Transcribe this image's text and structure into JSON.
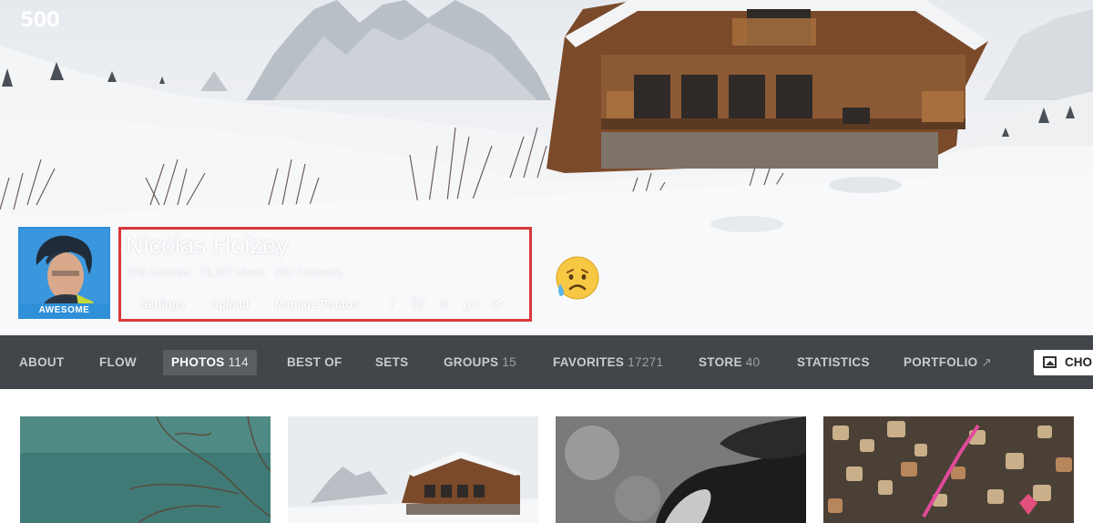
{
  "brand": {
    "logo_text": "500"
  },
  "profile": {
    "name": "Nicolas Hoizey",
    "avatar_badge": "AWESOME",
    "stats": {
      "affection": "976 Affection",
      "views": "78,387 Views",
      "followers": "353 Followers"
    },
    "actions": {
      "settings": "Settings",
      "upload": "Upload",
      "manage_photos": "Manage Photos"
    },
    "social_icons": [
      "facebook-icon",
      "twitter-icon",
      "pinterest-icon",
      "google-plus-icon",
      "email-icon"
    ]
  },
  "annotation": {
    "highlight_color": "#d9383a",
    "emoji": "sad-face-with-sweat-emoji"
  },
  "nav": {
    "items": [
      {
        "label": "ABOUT",
        "count": ""
      },
      {
        "label": "FLOW",
        "count": ""
      },
      {
        "label": "PHOTOS",
        "count": "114",
        "active": true
      },
      {
        "label": "BEST OF",
        "count": ""
      },
      {
        "label": "SETS",
        "count": ""
      },
      {
        "label": "GROUPS",
        "count": "15"
      },
      {
        "label": "FAVORITES",
        "count": "17271"
      },
      {
        "label": "STORE",
        "count": "40"
      },
      {
        "label": "STATISTICS",
        "count": ""
      },
      {
        "label": "PORTFOLIO",
        "count": "↗"
      }
    ],
    "choose_label": "CHO"
  },
  "colors": {
    "nav_bg": "#42454a",
    "nav_text": "#c9cbce",
    "avatar_blue": "#2f8fd8"
  }
}
